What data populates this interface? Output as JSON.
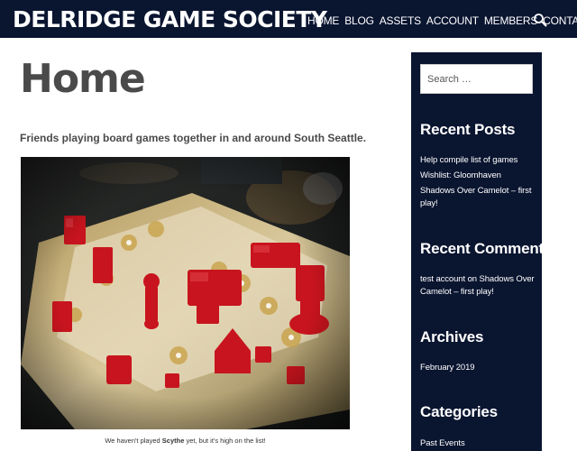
{
  "header": {
    "site_title": "DELRIDGE GAME SOCIETY",
    "nav": [
      "HOME",
      "BLOG",
      "ASSETS",
      "ACCOUNT",
      "MEMBERS",
      "CONTACT"
    ],
    "search_icon": "search-icon"
  },
  "main": {
    "title": "Home",
    "intro": "Friends playing board games together in and around South Seattle.",
    "caption_before": "We haven't played ",
    "caption_game": "Scythe",
    "caption_after": " yet, but it's high on the list!"
  },
  "sidebar": {
    "search_placeholder": "Search …",
    "recent_posts_title": "Recent Posts",
    "recent_posts": [
      "Help compile list of games",
      "Wishlist: Gloomhaven",
      "Shadows Over Camelot – first play!"
    ],
    "recent_comments_title": "Recent Comments",
    "comment_author": "test account",
    "comment_on": " on ",
    "comment_post": "Shadows Over Camelot – first play!",
    "archives_title": "Archives",
    "archives": [
      "February 2019"
    ],
    "categories_title": "Categories",
    "categories": [
      "Past Events"
    ]
  },
  "colors": {
    "navy": "#0a1530",
    "heading_gray": "#4a4a4a",
    "meeple_red": "#c8141e"
  }
}
